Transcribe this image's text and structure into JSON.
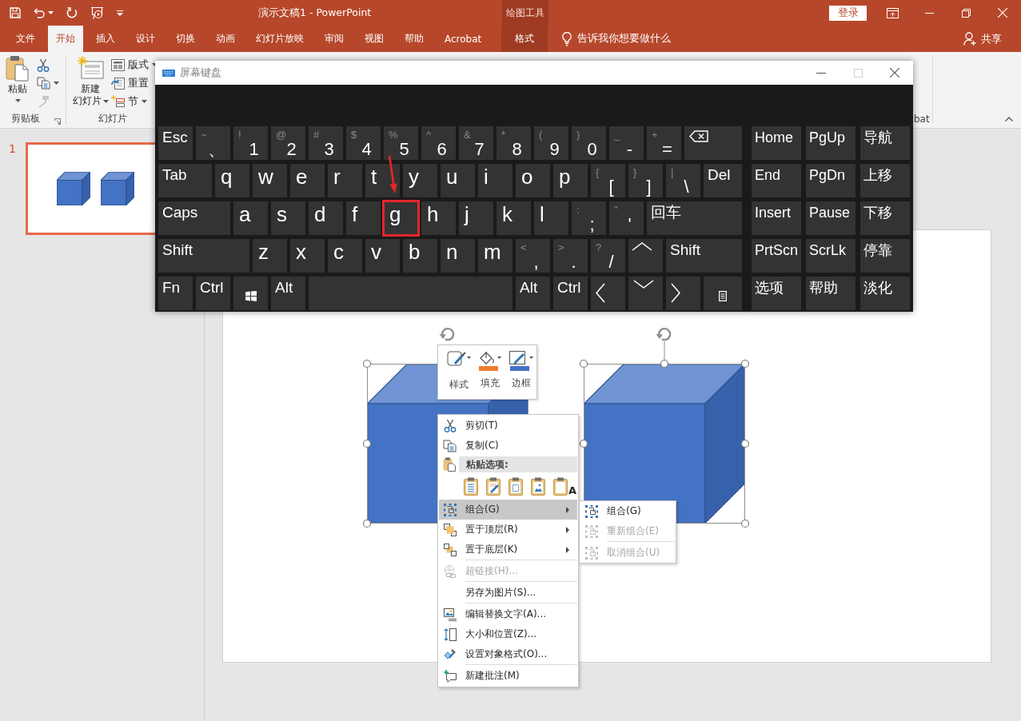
{
  "titlebar": {
    "title": "演示文稿1 - PowerPoint",
    "context_label": "绘图工具",
    "sign_in": "登录"
  },
  "tabs": [
    {
      "label": "文件",
      "kind": "normal",
      "selected": false
    },
    {
      "label": "开始",
      "kind": "normal",
      "selected": true
    },
    {
      "label": "插入",
      "kind": "normal",
      "selected": false
    },
    {
      "label": "设计",
      "kind": "normal",
      "selected": false
    },
    {
      "label": "切换",
      "kind": "normal",
      "selected": false
    },
    {
      "label": "动画",
      "kind": "normal",
      "selected": false
    },
    {
      "label": "幻灯片放映",
      "kind": "normal",
      "selected": false
    },
    {
      "label": "审阅",
      "kind": "normal",
      "selected": false
    },
    {
      "label": "视图",
      "kind": "normal",
      "selected": false
    },
    {
      "label": "帮助",
      "kind": "normal",
      "selected": false
    },
    {
      "label": "Acrobat",
      "kind": "normal",
      "selected": false
    },
    {
      "label": "格式",
      "kind": "contextual",
      "selected": false
    }
  ],
  "tell_me": "告诉我你想要做什么",
  "share": "共享",
  "ribbon": {
    "clipboard": {
      "label": "剪贴板",
      "paste": {
        "label": "粘贴",
        "dropdown": true
      },
      "tools": [
        {
          "kind": "cut",
          "dropdown": false,
          "disabled": false
        },
        {
          "kind": "copy",
          "dropdown": true,
          "disabled": false
        },
        {
          "kind": "painter",
          "dropdown": false,
          "disabled": true
        }
      ]
    },
    "slides": {
      "label": "幻灯片",
      "new_slide": {
        "lines": [
          "新建",
          "幻灯片"
        ],
        "dropdown": true
      },
      "tools": [
        {
          "kind": "layout",
          "label": "版式",
          "dropdown": true
        },
        {
          "kind": "reset",
          "label": "重置",
          "dropdown": false
        },
        {
          "kind": "section",
          "label": "节",
          "dropdown": true
        }
      ]
    },
    "trailing_group_label": "bat"
  },
  "slide_pane": [
    {
      "number": "1",
      "selected": true
    }
  ],
  "canvas": {
    "shapes": [
      {
        "kind": "cube",
        "selected": true
      },
      {
        "kind": "cube",
        "selected": true
      }
    ]
  },
  "mini_toolbar": [
    {
      "kind": "style",
      "label": "样式"
    },
    {
      "kind": "fill",
      "label": "填充",
      "color": "#ed7d31"
    },
    {
      "kind": "outline",
      "label": "边框",
      "color": "#4472c4"
    }
  ],
  "context_menu": {
    "top": [
      {
        "kind": "cut",
        "label": "剪切(T)",
        "selected": false,
        "disabled": false,
        "submenu": false
      },
      {
        "kind": "copy",
        "label": "复制(C)",
        "selected": false,
        "disabled": false,
        "submenu": false
      }
    ],
    "paste": {
      "header": "粘贴选项:",
      "options": [
        {
          "kind": "keep"
        },
        {
          "kind": "theme"
        },
        {
          "kind": "embed"
        },
        {
          "kind": "picture"
        },
        {
          "kind": "text",
          "glyph": "A"
        }
      ]
    },
    "items": [
      {
        "kind": "group",
        "label": "组合(G)",
        "selected": true,
        "disabled": false,
        "submenu": true,
        "separator_before": false
      },
      {
        "kind": "front",
        "label": "置于顶层(R)",
        "selected": false,
        "disabled": false,
        "submenu": true,
        "separator_before": false
      },
      {
        "kind": "back",
        "label": "置于底层(K)",
        "selected": false,
        "disabled": false,
        "submenu": true,
        "separator_before": false
      },
      {
        "kind": "link",
        "label": "超链接(H)...",
        "selected": false,
        "disabled": true,
        "submenu": false,
        "separator_before": true
      },
      {
        "kind": "plain",
        "label": "另存为图片(S)...",
        "selected": false,
        "disabled": false,
        "submenu": false,
        "separator_before": true
      },
      {
        "kind": "alttext",
        "label": "编辑替换文字(A)...",
        "selected": false,
        "disabled": false,
        "submenu": false,
        "separator_before": true
      },
      {
        "kind": "size",
        "label": "大小和位置(Z)...",
        "selected": false,
        "disabled": false,
        "submenu": false,
        "separator_before": false
      },
      {
        "kind": "format",
        "label": "设置对象格式(O)...",
        "selected": false,
        "disabled": false,
        "submenu": false,
        "separator_before": false
      },
      {
        "kind": "comment",
        "label": "新建批注(M)",
        "selected": false,
        "disabled": false,
        "submenu": false,
        "separator_before": true
      }
    ]
  },
  "submenu": [
    {
      "label": "组合(G)",
      "selected": false,
      "disabled": false,
      "separator_before": false
    },
    {
      "label": "重新组合(E)",
      "selected": false,
      "disabled": true,
      "separator_before": false
    },
    {
      "label": "取消组合(U)",
      "selected": false,
      "disabled": true,
      "separator_before": true
    }
  ],
  "keyboard": {
    "title": "屏幕键盘",
    "window_buttons": [
      {
        "kind": "minimize",
        "disabled": false
      },
      {
        "kind": "maximize",
        "disabled": true
      },
      {
        "kind": "close",
        "disabled": false
      }
    ],
    "rows": [
      {
        "keys": [
          {
            "kind": "label",
            "label": "Esc",
            "marked": false
          },
          {
            "kind": "char",
            "shift": "~",
            "main": "、",
            "marked": false
          },
          {
            "kind": "char",
            "shift": "!",
            "main": "1",
            "marked": false
          },
          {
            "kind": "char",
            "shift": "@",
            "main": "2",
            "marked": false
          },
          {
            "kind": "char",
            "shift": "#",
            "main": "3",
            "marked": false
          },
          {
            "kind": "char",
            "shift": "$",
            "main": "4",
            "marked": false
          },
          {
            "kind": "char",
            "shift": "%",
            "main": "5",
            "marked": false
          },
          {
            "kind": "char",
            "shift": "^",
            "main": "6",
            "marked": false
          },
          {
            "kind": "char",
            "shift": "&",
            "main": "7",
            "marked": false
          },
          {
            "kind": "char",
            "shift": "*",
            "main": "8",
            "marked": false
          },
          {
            "kind": "char",
            "shift": "(",
            "main": "9",
            "marked": false
          },
          {
            "kind": "char",
            "shift": ")",
            "main": "0",
            "marked": false
          },
          {
            "kind": "char",
            "shift": "_",
            "main": "-",
            "marked": false
          },
          {
            "kind": "char",
            "shift": "+",
            "main": "=",
            "marked": false
          },
          {
            "kind": "backspace",
            "marked": false
          }
        ]
      },
      {
        "keys": [
          {
            "kind": "label",
            "label": "Tab",
            "marked": false
          },
          {
            "kind": "letter",
            "main": "q",
            "marked": false
          },
          {
            "kind": "letter",
            "main": "w",
            "marked": false
          },
          {
            "kind": "letter",
            "main": "e",
            "marked": false
          },
          {
            "kind": "letter",
            "main": "r",
            "marked": false
          },
          {
            "kind": "letter",
            "main": "t",
            "marked": false
          },
          {
            "kind": "letter",
            "main": "y",
            "marked": false
          },
          {
            "kind": "letter",
            "main": "u",
            "marked": false
          },
          {
            "kind": "letter",
            "main": "i",
            "marked": false
          },
          {
            "kind": "letter",
            "main": "o",
            "marked": false
          },
          {
            "kind": "letter",
            "main": "p",
            "marked": false
          },
          {
            "kind": "char",
            "shift": "{",
            "main": "[",
            "marked": false
          },
          {
            "kind": "char",
            "shift": "}",
            "main": "]",
            "marked": false
          },
          {
            "kind": "char",
            "shift": "|",
            "main": "\\",
            "marked": false
          },
          {
            "kind": "label",
            "label": "Del",
            "marked": false
          }
        ]
      },
      {
        "keys": [
          {
            "kind": "label",
            "label": "Caps",
            "marked": false
          },
          {
            "kind": "letter",
            "main": "a",
            "marked": false
          },
          {
            "kind": "letter",
            "main": "s",
            "marked": false
          },
          {
            "kind": "letter",
            "main": "d",
            "marked": false
          },
          {
            "kind": "letter",
            "main": "f",
            "marked": false
          },
          {
            "kind": "letter",
            "main": "g",
            "marked": true
          },
          {
            "kind": "letter",
            "main": "h",
            "marked": false
          },
          {
            "kind": "letter",
            "main": "j",
            "marked": false
          },
          {
            "kind": "letter",
            "main": "k",
            "marked": false
          },
          {
            "kind": "letter",
            "main": "l",
            "marked": false
          },
          {
            "kind": "char",
            "shift": ":",
            "main": ";",
            "marked": false
          },
          {
            "kind": "char",
            "shift": "\"",
            "main": "'",
            "marked": false
          },
          {
            "kind": "label",
            "label": "回车",
            "marked": false
          }
        ]
      },
      {
        "keys": [
          {
            "kind": "label",
            "label": "Shift",
            "marked": false
          },
          {
            "kind": "letter",
            "main": "z",
            "marked": false
          },
          {
            "kind": "letter",
            "main": "x",
            "marked": false
          },
          {
            "kind": "letter",
            "main": "c",
            "marked": false
          },
          {
            "kind": "letter",
            "main": "v",
            "marked": false
          },
          {
            "kind": "letter",
            "main": "b",
            "marked": false
          },
          {
            "kind": "letter",
            "main": "n",
            "marked": false
          },
          {
            "kind": "letter",
            "main": "m",
            "marked": false
          },
          {
            "kind": "char",
            "shift": "<",
            "main": ",",
            "marked": false
          },
          {
            "kind": "char",
            "shift": ">",
            "main": ".",
            "marked": false
          },
          {
            "kind": "char",
            "shift": "?",
            "main": "/",
            "marked": false
          },
          {
            "kind": "up",
            "marked": false
          },
          {
            "kind": "label",
            "label": "Shift",
            "marked": false
          }
        ]
      },
      {
        "keys": [
          {
            "kind": "label",
            "label": "Fn",
            "marked": false
          },
          {
            "kind": "label",
            "label": "Ctrl",
            "marked": false
          },
          {
            "kind": "windows",
            "marked": false
          },
          {
            "kind": "label",
            "label": "Alt",
            "marked": false
          },
          {
            "kind": "space",
            "marked": false
          },
          {
            "kind": "label",
            "label": "Alt",
            "marked": false
          },
          {
            "kind": "label",
            "label": "Ctrl",
            "marked": false
          },
          {
            "kind": "left",
            "marked": false
          },
          {
            "kind": "down",
            "marked": false
          },
          {
            "kind": "right",
            "marked": false
          },
          {
            "kind": "menu",
            "marked": false
          }
        ]
      }
    ],
    "nav": [
      "Home",
      "PgUp",
      "导航",
      "End",
      "PgDn",
      "上移",
      "Insert",
      "Pause",
      "下移",
      "PrtScn",
      "ScrLk",
      "停靠",
      "选项",
      "帮助",
      "淡化"
    ]
  }
}
